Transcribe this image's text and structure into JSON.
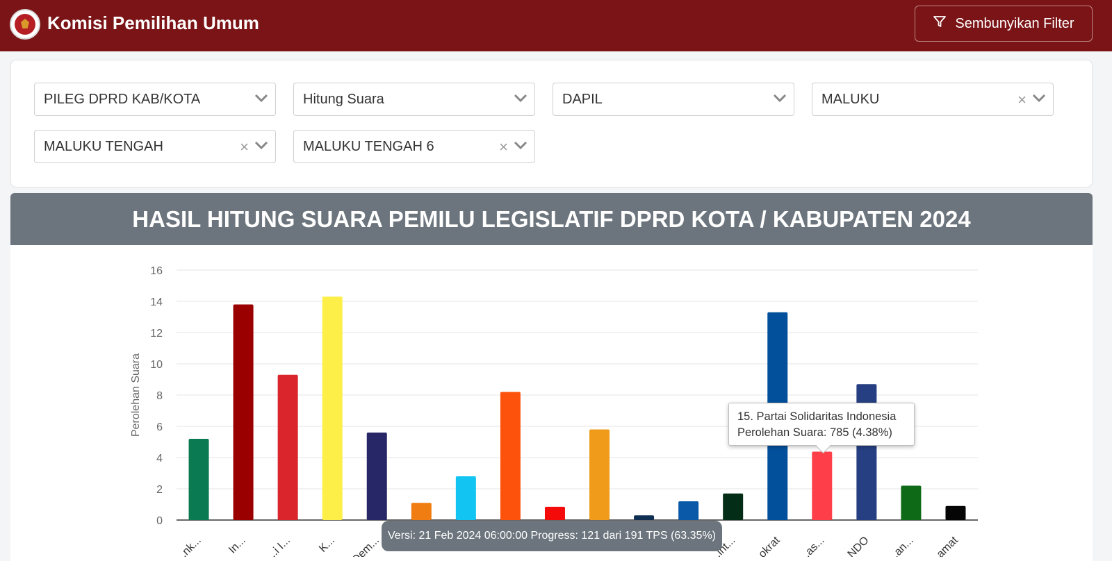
{
  "header": {
    "title": "Komisi Pemilihan Umum",
    "filter_button_label": "Sembunyikan Filter"
  },
  "filters": [
    {
      "value": "PILEG DPRD KAB/KOTA",
      "clearable": false
    },
    {
      "value": "Hitung Suara",
      "clearable": false
    },
    {
      "value": "DAPIL",
      "clearable": false
    },
    {
      "value": "MALUKU",
      "clearable": true
    },
    {
      "value": "MALUKU TENGAH",
      "clearable": true
    },
    {
      "value": "MALUKU TENGAH 6",
      "clearable": true
    }
  ],
  "chart_title": "HASIL HITUNG SUARA PEMILU LEGISLATIF DPRD KOTA / KABUPATEN 2024",
  "chart_data": {
    "type": "bar",
    "ylabel": "Perolehan Suara",
    "ylim": [
      0,
      16
    ],
    "yticks": [
      0,
      2,
      4,
      6,
      8,
      10,
      12,
      14,
      16
    ],
    "categories": [
      "...nk...",
      "In...",
      "...i I...",
      "K...",
      "Dem...",
      "...",
      "...",
      "...",
      "...",
      "...",
      "...",
      "...",
      "...int...",
      "...okrat",
      "...as...",
      "...NDO",
      "...an...",
      "...amat"
    ],
    "values": [
      5.2,
      13.8,
      9.3,
      14.3,
      5.6,
      1.1,
      2.8,
      8.2,
      0.85,
      5.8,
      0.3,
      1.2,
      1.7,
      13.3,
      4.38,
      8.7,
      2.2,
      0.9
    ],
    "colors": [
      "#0a7a52",
      "#9a0000",
      "#d9252b",
      "#fdee48",
      "#272767",
      "#f07d12",
      "#12c4f2",
      "#fd520c",
      "#f50a0a",
      "#f09b1a",
      "#0f2e52",
      "#0a59a8",
      "#042d17",
      "#02509b",
      "#fe3e49",
      "#263f82",
      "#0f6a18",
      "#050505"
    ]
  },
  "tooltip": {
    "line1": "15. Partai Solidaritas Indonesia",
    "line2": "Perolehan Suara: 785 (4.38%)"
  },
  "version_text": "Versi: 21 Feb 2024 06:00:00 Progress: 121 dari 191 TPS (63.35%)"
}
